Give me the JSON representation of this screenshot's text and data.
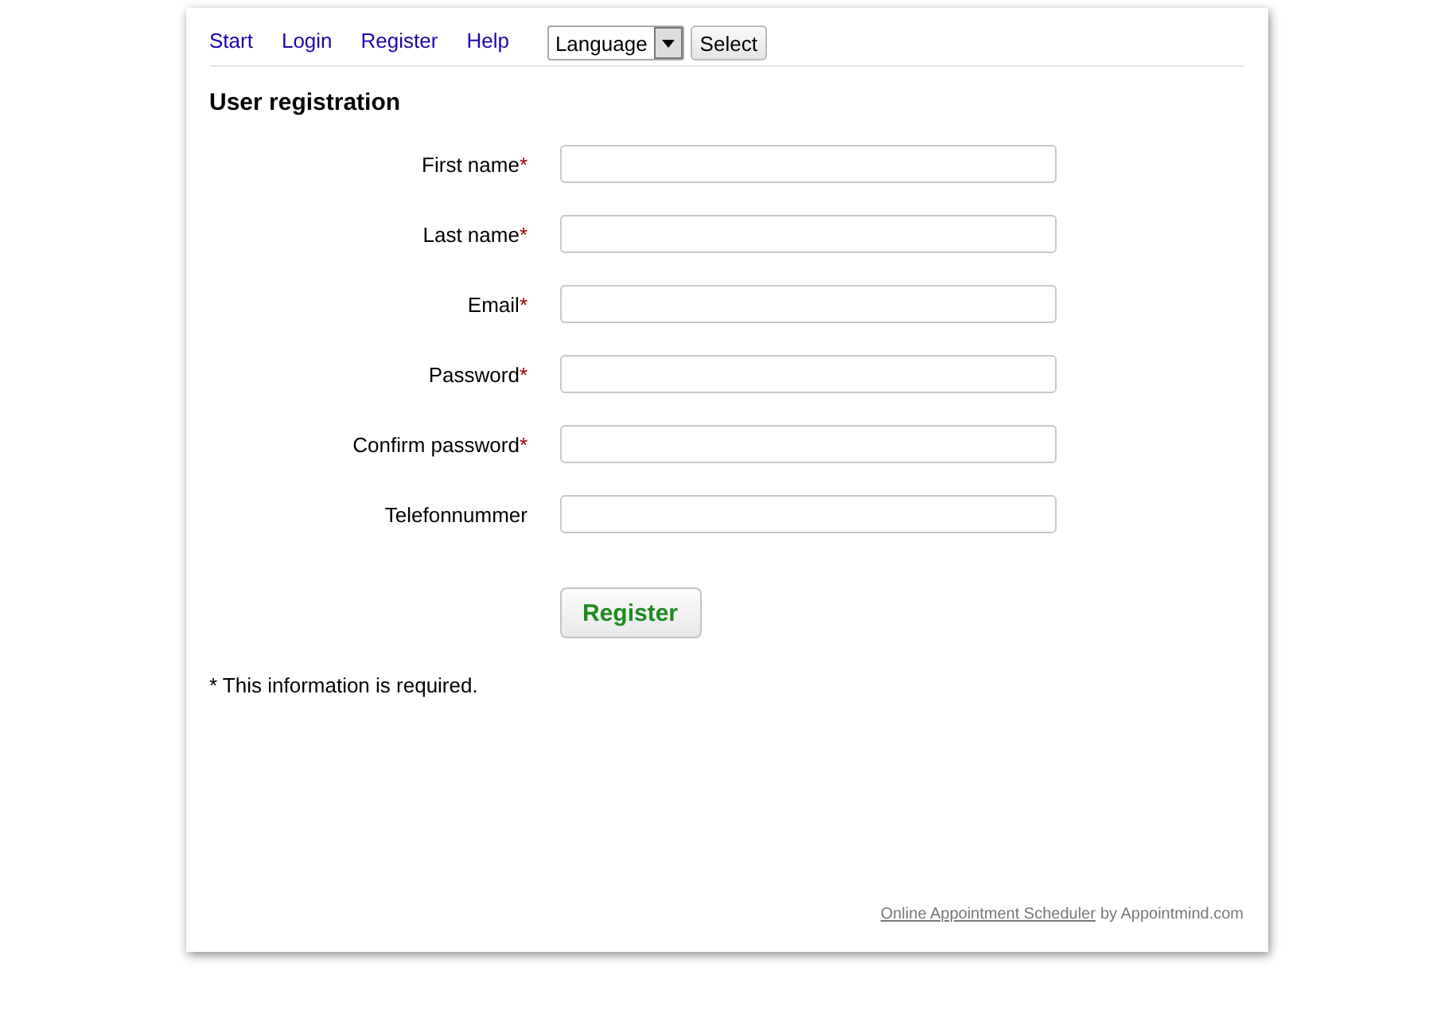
{
  "nav": {
    "links": [
      "Start",
      "Login",
      "Register",
      "Help"
    ],
    "language": {
      "value": "Language"
    },
    "select_button": "Select"
  },
  "title": "User registration",
  "fields": [
    {
      "label": "First name",
      "mark": "*"
    },
    {
      "label": "Last name",
      "mark": "*"
    },
    {
      "label": "Email",
      "mark": "*"
    },
    {
      "label": "Password",
      "mark": "*"
    },
    {
      "label": "Confirm password",
      "mark": "*"
    },
    {
      "label": "Telefonnummer"
    }
  ],
  "submit": "Register",
  "note": "* This information is required.",
  "footer": {
    "link": "Online Appointment Scheduler",
    "text": "by Appointmind.com"
  }
}
